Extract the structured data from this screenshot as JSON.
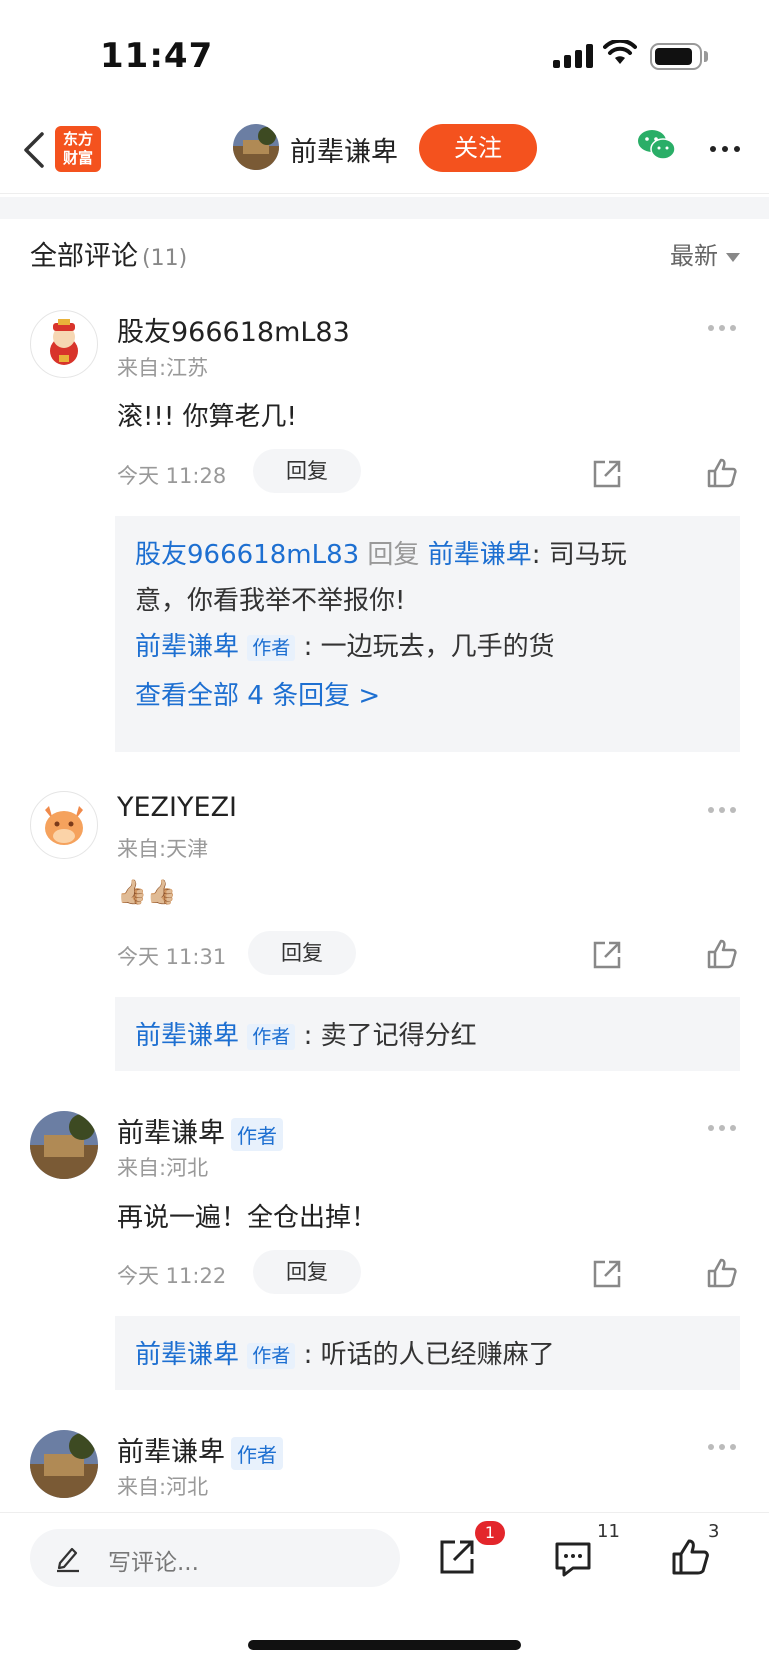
{
  "status": {
    "time": "11:47"
  },
  "nav": {
    "logo_line1": "东方",
    "logo_line2": "财富",
    "author": "前辈谦卑",
    "follow_label": "关注"
  },
  "comments_header": {
    "title": "全部评论",
    "count": "(11)",
    "sort": "最新"
  },
  "comments": [
    {
      "user": "股友966618mL83",
      "from": "来自:江苏",
      "text": "滚!!!  你算老几!",
      "time": "今天 11:28",
      "reply_label": "回复",
      "replies": [
        {
          "user": "股友966618mL83",
          "mid": " 回复 ",
          "target": "前辈谦卑",
          "sep": ":",
          "text_a": " 司马玩",
          "text_b": "意，你看我举不举报你!"
        },
        {
          "user": "前辈谦卑",
          "tag": "作者",
          "sep": ":",
          "text": " 一边玩去，几手的货"
        }
      ],
      "view_all": "查看全部 4 条回复 >"
    },
    {
      "user": "YEZIYEZI",
      "from": "来自:天津",
      "text": "👍🏼👍🏼",
      "time": "今天 11:31",
      "reply_label": "回复",
      "replies": [
        {
          "user": "前辈谦卑",
          "tag": "作者",
          "sep": ":",
          "text": " 卖了记得分红"
        }
      ]
    },
    {
      "user": "前辈谦卑",
      "tag": "作者",
      "from": "来自:河北",
      "text": "再说一遍！全仓出掉！",
      "time": "今天 11:22",
      "reply_label": "回复",
      "replies": [
        {
          "user": "前辈谦卑",
          "tag": "作者",
          "sep": ":",
          "text": " 听话的人已经赚麻了"
        }
      ]
    },
    {
      "user": "前辈谦卑",
      "tag": "作者",
      "from": "来自:河北"
    }
  ],
  "bottom": {
    "placeholder": "写评论...",
    "share_badge": "1",
    "comment_count": "11",
    "like_count": "3"
  }
}
